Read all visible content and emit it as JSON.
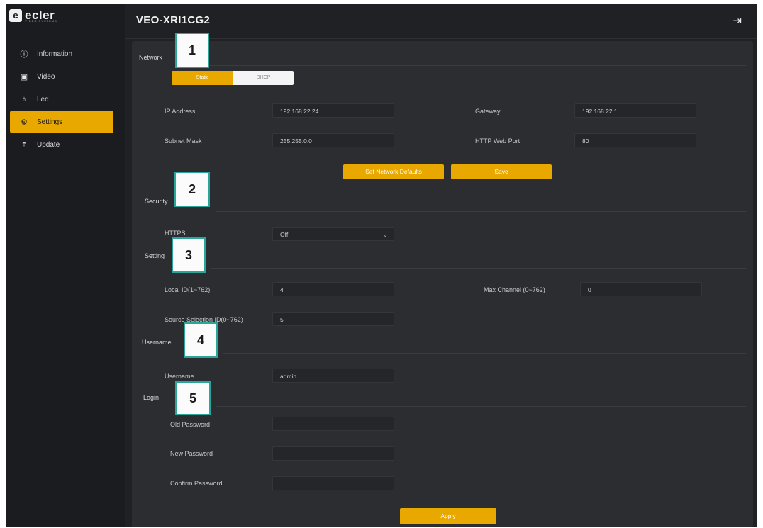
{
  "brand": {
    "mark": "e",
    "name": "ecler",
    "sub": "VIDEO SYSTEMS"
  },
  "sidebar": {
    "items": [
      {
        "label": "Information",
        "icon": "info-icon"
      },
      {
        "label": "Video",
        "icon": "video-icon"
      },
      {
        "label": "Led",
        "icon": "bulb-icon"
      },
      {
        "label": "Settings",
        "icon": "gear-icon",
        "active": true
      },
      {
        "label": "Update",
        "icon": "upload-icon"
      }
    ]
  },
  "header": {
    "title": "VEO-XRI1CG2",
    "logout_icon": "logout-icon"
  },
  "network": {
    "section": "Network",
    "mode_static": "Static",
    "mode_dhcp": "DHCP",
    "ip_label": "IP Address",
    "ip_value": "192.168.22.24",
    "gateway_label": "Gateway",
    "gateway_value": "192.168.22.1",
    "subnet_label": "Subnet Mask",
    "subnet_value": "255.255.0.0",
    "port_label": "HTTP Web Port",
    "port_value": "80",
    "defaults_button": "Set Network Defaults",
    "save_button": "Save"
  },
  "security": {
    "section": "Security",
    "https_label": "HTTPS",
    "https_value": "Off"
  },
  "setting": {
    "section": "Setting",
    "local_id_label": "Local ID(1~762)",
    "local_id_value": "4",
    "max_channel_label": "Max Channel (0~762)",
    "max_channel_value": "0",
    "source_label": "Source Selection ID(0~762)",
    "source_value": "5"
  },
  "username": {
    "section": "Username",
    "label": "Username",
    "value": "admin"
  },
  "login": {
    "section": "Login",
    "old_label": "Old Password",
    "new_label": "New Password",
    "confirm_label": "Confirm Password",
    "apply_button": "Apply"
  },
  "callouts": [
    "1",
    "2",
    "3",
    "4",
    "5"
  ],
  "colors": {
    "accent": "#e8a800",
    "background": "#1f2124",
    "panel": "#2b2d30",
    "callout_border": "#2aa59a"
  }
}
